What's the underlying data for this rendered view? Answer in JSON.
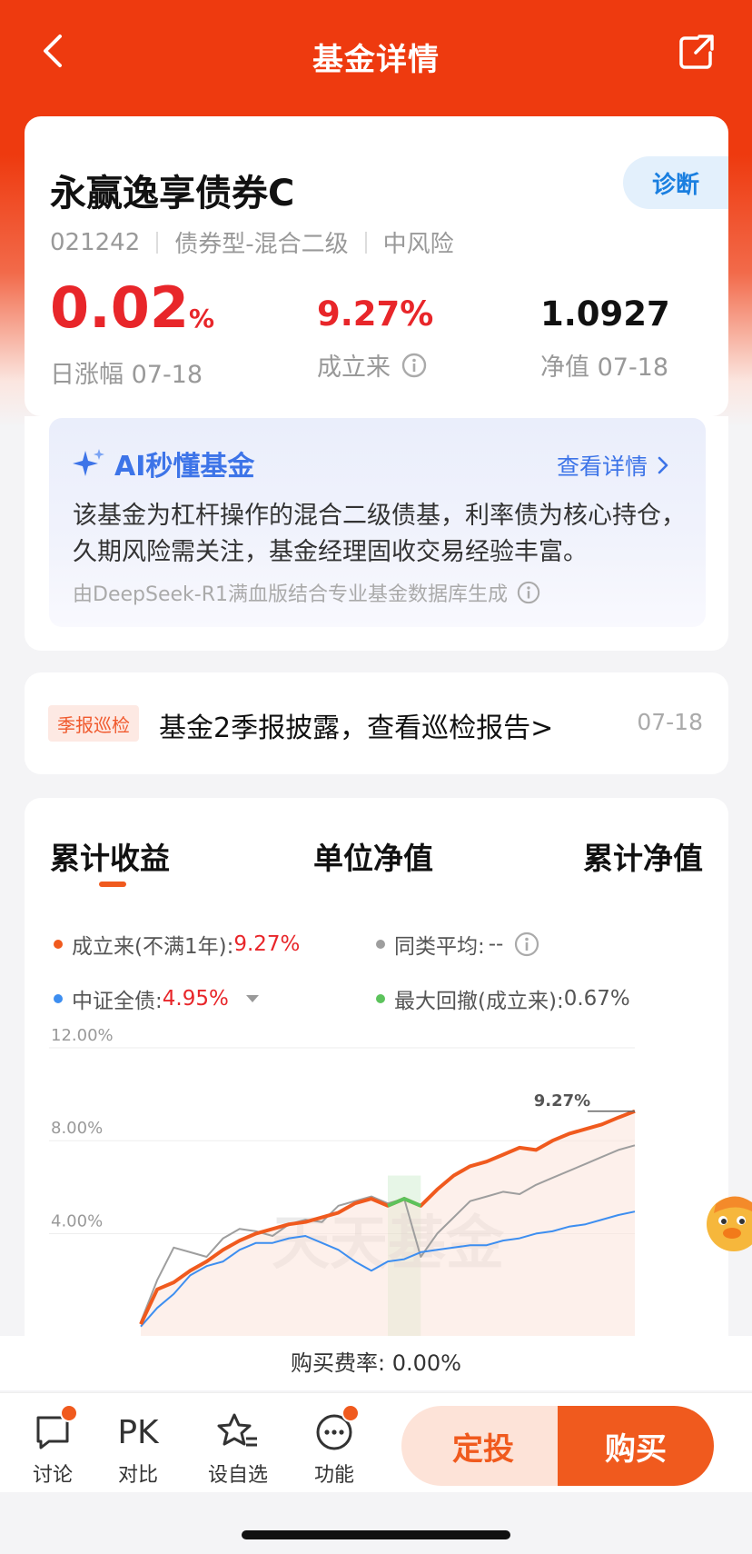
{
  "nav": {
    "title": "基金详情",
    "back_icon": "chevron-left-icon",
    "share_icon": "share-icon"
  },
  "fund": {
    "name": "永赢逸享债券C",
    "diagnose_label": "诊断",
    "code": "021242",
    "type": "债券型-混合二级",
    "risk": "中风险",
    "daily_change": "0.02",
    "daily_change_unit": "%",
    "daily_change_label": "日涨幅 07-18",
    "since_inception": "9.27%",
    "since_inception_label": "成立来",
    "nav_value": "1.0927",
    "nav_label": "净值 07-18"
  },
  "ai": {
    "title": "AI秒懂基金",
    "more_label": "查看详情",
    "text": "该基金为杠杆操作的混合二级债基，利率债为核心持仓，久期风险需关注，基金经理固收交易经验丰富。",
    "footer": "由DeepSeek-R1满血版结合专业基金数据库生成"
  },
  "report": {
    "tag": "季报巡检",
    "text": "基金2季报披露，查看巡检报告>",
    "date": "07-18"
  },
  "chart_tabs": [
    "累计收益",
    "单位净值",
    "累计净值"
  ],
  "legend": {
    "since_label": "成立来(不满1年):",
    "since_value": "9.27%",
    "peer_label": "同类平均:",
    "peer_value": "--",
    "index_label": "中证全债:",
    "index_value": "4.95%",
    "drawdown_label": "最大回撤(成立来):",
    "drawdown_value": "0.67%"
  },
  "colors": {
    "fund": "#f05a1e",
    "peer": "#9e9e9e",
    "index": "#3d8ef0",
    "drawdown": "#5cc35c",
    "red": "#e8262a"
  },
  "watermark": "天天基金",
  "chart_data": {
    "type": "line",
    "ylim": [
      0,
      12
    ],
    "yticks": [
      "12.00%",
      "8.00%",
      "4.00%"
    ],
    "end_label": "9.27%",
    "series": [
      {
        "name": "成立来",
        "values": [
          0.1,
          1.6,
          1.9,
          2.4,
          2.8,
          3.3,
          3.7,
          4.0,
          4.2,
          4.4,
          4.5,
          4.7,
          4.9,
          5.3,
          5.5,
          5.2,
          5.5,
          5.2,
          5.9,
          6.5,
          6.9,
          7.1,
          7.4,
          7.7,
          7.6,
          8.0,
          8.3,
          8.5,
          8.7,
          9.0,
          9.27
        ]
      },
      {
        "name": "同类平均",
        "values": [
          0.2,
          2.0,
          3.4,
          3.2,
          3.0,
          3.8,
          4.2,
          4.1,
          3.9,
          4.4,
          4.6,
          4.5,
          5.2,
          5.4,
          5.6,
          5.3,
          5.5,
          3.0,
          4.0,
          4.7,
          5.4,
          5.6,
          5.8,
          5.7,
          6.1,
          6.4,
          6.7,
          7.0,
          7.3,
          7.6,
          7.8
        ]
      },
      {
        "name": "中证全债",
        "values": [
          0.0,
          0.8,
          1.4,
          2.2,
          2.6,
          2.8,
          3.3,
          3.6,
          3.6,
          3.8,
          3.9,
          3.6,
          3.3,
          2.8,
          2.4,
          2.8,
          2.9,
          3.2,
          3.3,
          3.4,
          3.5,
          3.5,
          3.7,
          3.8,
          4.0,
          4.1,
          4.3,
          4.4,
          4.6,
          4.8,
          4.95
        ]
      }
    ],
    "drawdown_range": [
      15,
      17
    ]
  },
  "fee": {
    "label": "购买费率:",
    "value": "0.00%"
  },
  "toolbar": {
    "discuss": "讨论",
    "pk_icon": "PK",
    "compare": "对比",
    "watch": "设自选",
    "function": "功能",
    "auto_invest": "定投",
    "buy": "购买"
  }
}
